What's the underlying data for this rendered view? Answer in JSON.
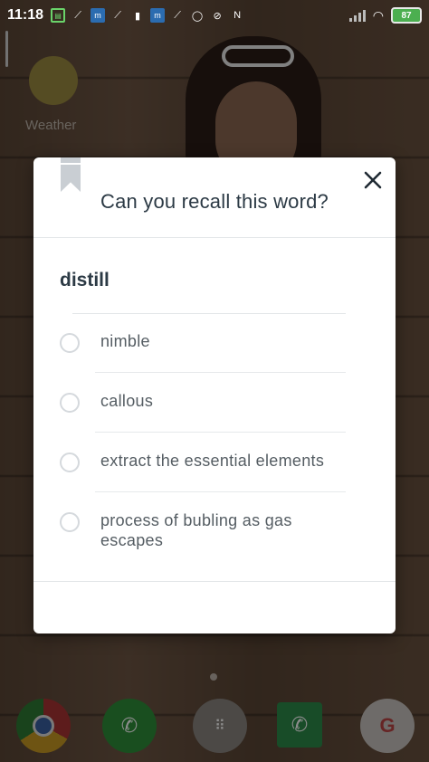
{
  "status_bar": {
    "time": "11:18",
    "battery": "87",
    "notification_icons": [
      "sim-icon",
      "app-icon",
      "bank-icon",
      "app-icon",
      "book-icon",
      "bank-icon",
      "app-icon",
      "whatsapp-icon",
      "block-icon",
      "news-icon"
    ]
  },
  "home": {
    "weather_label": "Weather"
  },
  "dialog": {
    "title": "Can you recall this word?",
    "word": "distill",
    "options": [
      {
        "label": "nimble"
      },
      {
        "label": "callous"
      },
      {
        "label": "extract the essential elements"
      },
      {
        "label": "process of bubling as gas escapes"
      }
    ]
  },
  "colors": {
    "dialog_bg": "#ffffff",
    "title_text": "#2c3a45",
    "option_text": "#555d63",
    "radio_border": "#d5d9dd",
    "bookmark": "#c9ced3"
  }
}
